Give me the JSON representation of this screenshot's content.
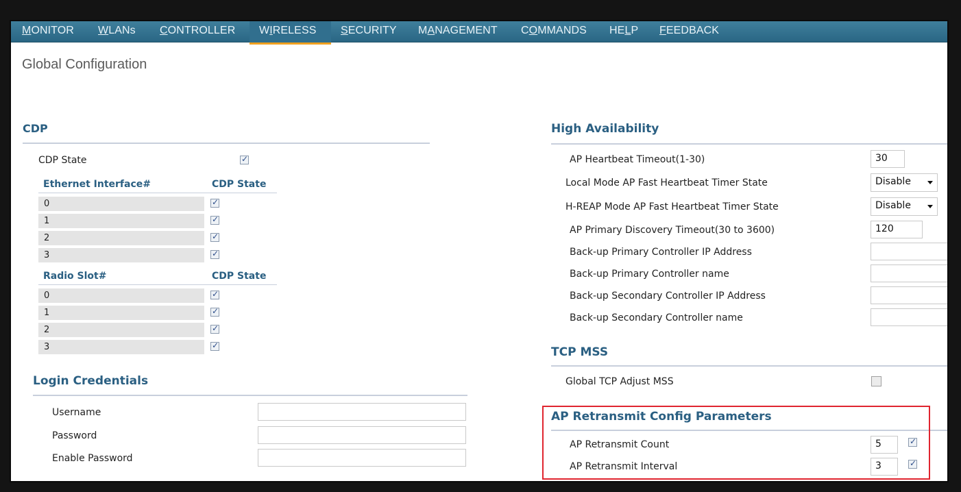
{
  "nav": {
    "items": [
      {
        "pre": "",
        "u": "M",
        "post": "ONITOR"
      },
      {
        "pre": "",
        "u": "W",
        "post": "LANs"
      },
      {
        "pre": "",
        "u": "C",
        "post": "ONTROLLER"
      },
      {
        "pre": "W",
        "u": "I",
        "post": "RELESS"
      },
      {
        "pre": "",
        "u": "S",
        "post": "ECURITY"
      },
      {
        "pre": "M",
        "u": "A",
        "post": "NAGEMENT"
      },
      {
        "pre": "C",
        "u": "O",
        "post": "MMANDS"
      },
      {
        "pre": "HE",
        "u": "L",
        "post": "P"
      },
      {
        "pre": "",
        "u": "F",
        "post": "EEDBACK"
      }
    ],
    "active": "WIRELESS",
    "accent_color": "#f0a020"
  },
  "page": {
    "title": "Global Configuration"
  },
  "cdp": {
    "title": "CDP",
    "state_label": "CDP State",
    "state_checked": true,
    "ethernet_header": "Ethernet Interface#",
    "radio_header": "Radio Slot#",
    "state_header": "CDP State",
    "ethernet_rows": [
      "0",
      "1",
      "2",
      "3"
    ],
    "radio_rows": [
      "0",
      "1",
      "2",
      "3"
    ]
  },
  "login": {
    "title": "Login Credentials",
    "username_label": "Username",
    "username_value": "",
    "password_label": "Password",
    "password_value": "",
    "enable_label": "Enable Password",
    "enable_value": ""
  },
  "ha": {
    "title": "High Availability",
    "heartbeat_label": "AP Heartbeat Timeout(1-30)",
    "heartbeat_value": "30",
    "local_label": "Local Mode AP Fast Heartbeat Timer State",
    "local_value": "Disable",
    "hreap_label": "H-REAP Mode AP Fast Heartbeat Timer State",
    "hreap_value": "Disable",
    "discovery_label": "AP Primary Discovery Timeout(30 to 3600)",
    "discovery_value": "120",
    "bk_primary_ip_label": "Back-up Primary Controller IP Address",
    "bk_primary_ip_value": "",
    "bk_primary_name_label": "Back-up Primary Controller name",
    "bk_primary_name_value": "",
    "bk_secondary_ip_label": "Back-up Secondary Controller IP Address",
    "bk_secondary_ip_value": "",
    "bk_secondary_name_label": "Back-up Secondary Controller name",
    "bk_secondary_name_value": ""
  },
  "tcp": {
    "title": "TCP MSS",
    "adjust_label": "Global TCP Adjust MSS",
    "adjust_checked": false
  },
  "retransmit": {
    "title": "AP Retransmit Config Parameters",
    "count_label": "AP Retransmit Count",
    "count_value": "5",
    "count_checked": true,
    "interval_label": "AP Retransmit Interval",
    "interval_value": "3",
    "interval_checked": true,
    "highlight_color": "#e0252f"
  }
}
